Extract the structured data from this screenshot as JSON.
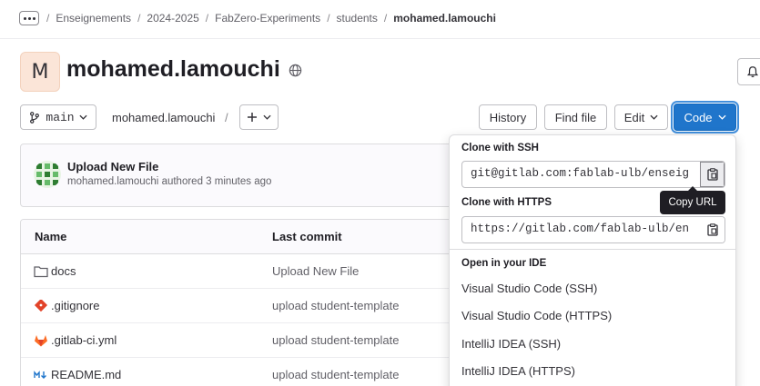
{
  "breadcrumb": {
    "more_icon": "ellipsis-icon",
    "items": [
      "Enseignements",
      "2024-2025",
      "FabZero-Experiments",
      "students",
      "mohamed.lamouchi"
    ]
  },
  "project": {
    "avatar_letter": "M",
    "name": "mohamed.lamouchi",
    "visibility_icon": "globe-icon"
  },
  "toolbar": {
    "branch": "main",
    "path": "mohamed.lamouchi",
    "path_separator": "/",
    "history": "History",
    "find_file": "Find file",
    "edit": "Edit",
    "code": "Code"
  },
  "last_commit": {
    "title": "Upload New File",
    "author": "mohamed.lamouchi",
    "meta_suffix": "authored 3 minutes ago"
  },
  "files": {
    "headers": [
      "Name",
      "Last commit"
    ],
    "rows": [
      {
        "name": "docs",
        "commit": "Upload New File",
        "icon": "folder-icon"
      },
      {
        "name": ".gitignore",
        "commit": "upload student-template",
        "icon": "git-icon"
      },
      {
        "name": ".gitlab-ci.yml",
        "commit": "upload student-template",
        "icon": "gitlab-icon"
      },
      {
        "name": "README.md",
        "commit": "upload student-template",
        "icon": "markdown-icon"
      }
    ]
  },
  "clone_menu": {
    "ssh_label": "Clone with SSH",
    "ssh_url": "git@gitlab.com:fablab-ulb/enseig",
    "https_label": "Clone with HTTPS",
    "https_url": "https://gitlab.com/fablab-ulb/en",
    "ide_label": "Open in your IDE",
    "ide_items": [
      "Visual Studio Code (SSH)",
      "Visual Studio Code (HTTPS)",
      "IntelliJ IDEA (SSH)",
      "IntelliJ IDEA (HTTPS)"
    ]
  },
  "tooltip": "Copy URL",
  "colors": {
    "primary": "#1f75cb",
    "avatar_bg": "#fbe5d8",
    "tooltip_bg": "#1f1e24"
  }
}
